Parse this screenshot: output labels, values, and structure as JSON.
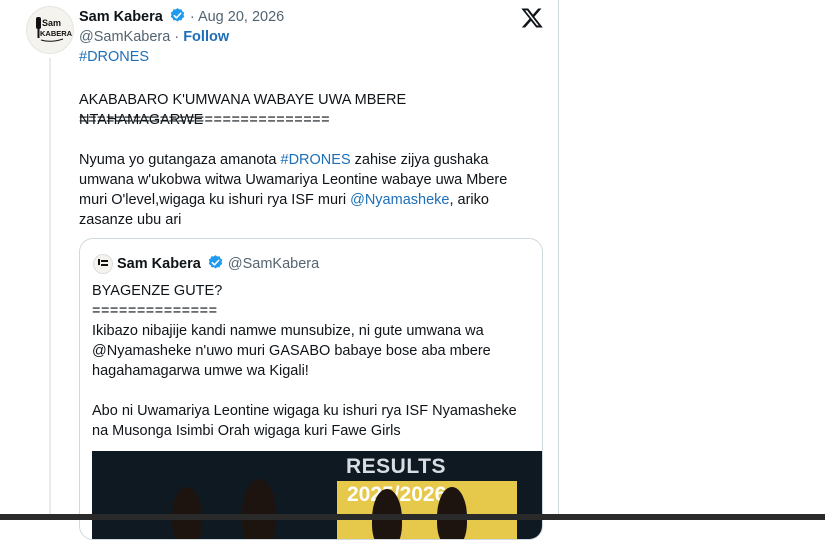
{
  "post": {
    "author_name": "Sam Kabera",
    "timestamp": "· Aug 20, 2026",
    "handle": "@SamKabera",
    "separator": "·",
    "follow_label": "Follow",
    "top_hashtag": "#DRONES",
    "avatar_text_1": "Sam",
    "avatar_text_2": "KABERA",
    "headline": "AKABABARO K'UMWANA WABAYE UWA MBERE NTAHAMAGARWE",
    "rule": "============================",
    "para_1_before": "Nyuma yo gutangaza amanota ",
    "para_1_hashtag": "#DRONES",
    "para_1_mid": " zahise zijya gushaka umwana w'ukobwa witwa Uwamariya Leontine wabaye uwa Mbere muri O'level,wigaga ku ishuri rya ISF muri ",
    "para_1_mention": "@Nyamasheke",
    "para_1_after": ", ariko zasanze ubu ari"
  },
  "quote": {
    "author_name": "Sam Kabera",
    "handle": "@SamKabera",
    "line_1": "BYAGENZE GUTE?",
    "line_2": "==============",
    "line_3": "Ikibazo nibajije kandi namwe munsubize, ni gute umwana wa @Nyamasheke n'uwo muri GASABO babaye bose aba mbere hagahamagarwa umwe wa Kigali!",
    "line_4": "Abo ni Uwamariya Leontine wigaga ku ishuri rya ISF Nyamasheke na Musonga Isimbi Orah wigaga kuri Fawe Girls",
    "image_text_1": "RESULTS",
    "image_text_2": "2025/2026"
  },
  "icons": {
    "verified": "verified-badge-icon",
    "x_logo": "x-logo-icon"
  },
  "colors": {
    "link": "#1d6fb8",
    "verified": "#1d9bf0",
    "muted": "#536471"
  }
}
